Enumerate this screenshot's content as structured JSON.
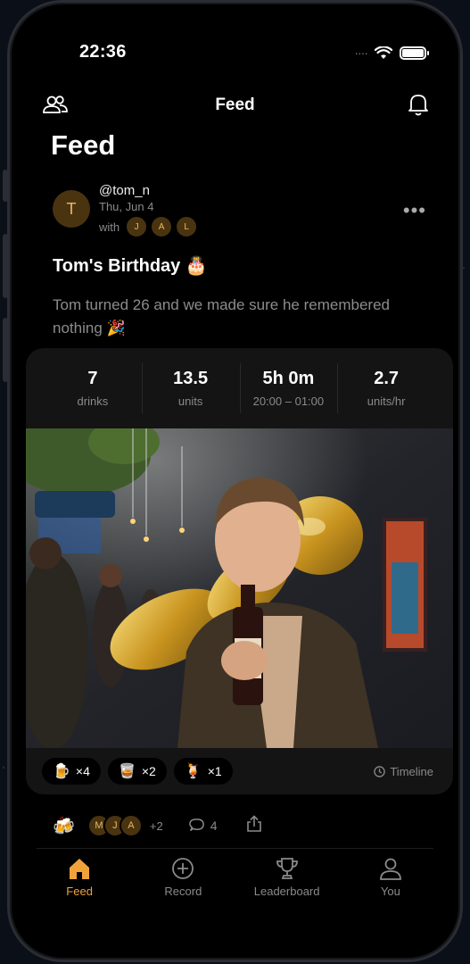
{
  "status_bar": {
    "time": "22:36",
    "signal": "····"
  },
  "nav": {
    "title": "Feed",
    "left_icon": "friends-icon",
    "right_icon": "bell-icon"
  },
  "page": {
    "title": "Feed"
  },
  "post": {
    "author": "@tom_n",
    "author_initial": "T",
    "date": "Thu, Jun 4",
    "with_label": "with",
    "with_users": [
      "J",
      "A",
      "L"
    ],
    "title": "Tom's Birthday 🎂",
    "description": "Tom turned 26 and we made sure he remembered nothing 🎉",
    "more_label": "•••",
    "stats": [
      {
        "value": "7",
        "label": "drinks"
      },
      {
        "value": "13.5",
        "label": "units"
      },
      {
        "value": "5h 0m",
        "label": "20:00 – 01:00"
      },
      {
        "value": "2.7",
        "label": "units/hr"
      }
    ],
    "drinks": [
      {
        "icon": "🍺",
        "count": "×4"
      },
      {
        "icon": "🥃",
        "count": "×2"
      },
      {
        "icon": "🍹",
        "count": "×1"
      }
    ],
    "timeline_label": "Timeline",
    "reaction_icon": "🍻",
    "reactors": [
      "M",
      "J",
      "A"
    ],
    "reactors_more": "+2",
    "comments_count": "4"
  },
  "tabs": [
    {
      "label": "Feed",
      "icon": "home-icon",
      "active": true
    },
    {
      "label": "Record",
      "icon": "plus-circle-icon",
      "active": false
    },
    {
      "label": "Leaderboard",
      "icon": "trophy-icon",
      "active": false
    },
    {
      "label": "You",
      "icon": "person-icon",
      "active": false
    }
  ],
  "colors": {
    "accent": "#f0a23a",
    "avatar_bg": "#4a3410",
    "avatar_fg": "#e7b968",
    "card": "#141414"
  }
}
